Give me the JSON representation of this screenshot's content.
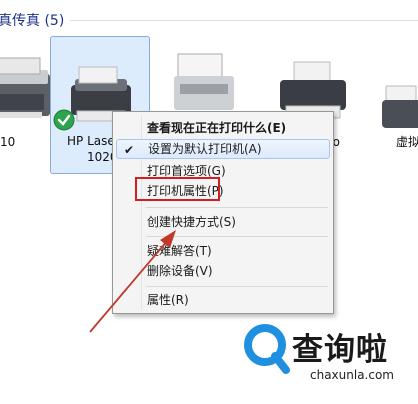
{
  "section": {
    "title": "真传真 (5)"
  },
  "devices": [
    {
      "label": "10"
    },
    {
      "label_line1": "HP Lase",
      "label_line2": "1020"
    },
    {
      "label": ""
    },
    {
      "label": "y Pro"
    },
    {
      "label": "虚拟"
    }
  ],
  "context_menu": {
    "items": [
      {
        "label": "查看现在正在打印什么(E)",
        "bold": true
      },
      {
        "label": "设置为默认打印机(A)",
        "checked": true,
        "check": "✔"
      },
      {
        "label": "打印首选项(G)"
      },
      {
        "label": "打印机属性(P)"
      },
      {
        "label": "创建快捷方式(S)"
      },
      {
        "label": "疑难解答(T)"
      },
      {
        "label": "删除设备(V)"
      },
      {
        "label": "属性(R)"
      }
    ]
  },
  "watermark": {
    "name": "查询啦",
    "url": "chaxunla.com",
    "color": "#1f8fe0"
  }
}
